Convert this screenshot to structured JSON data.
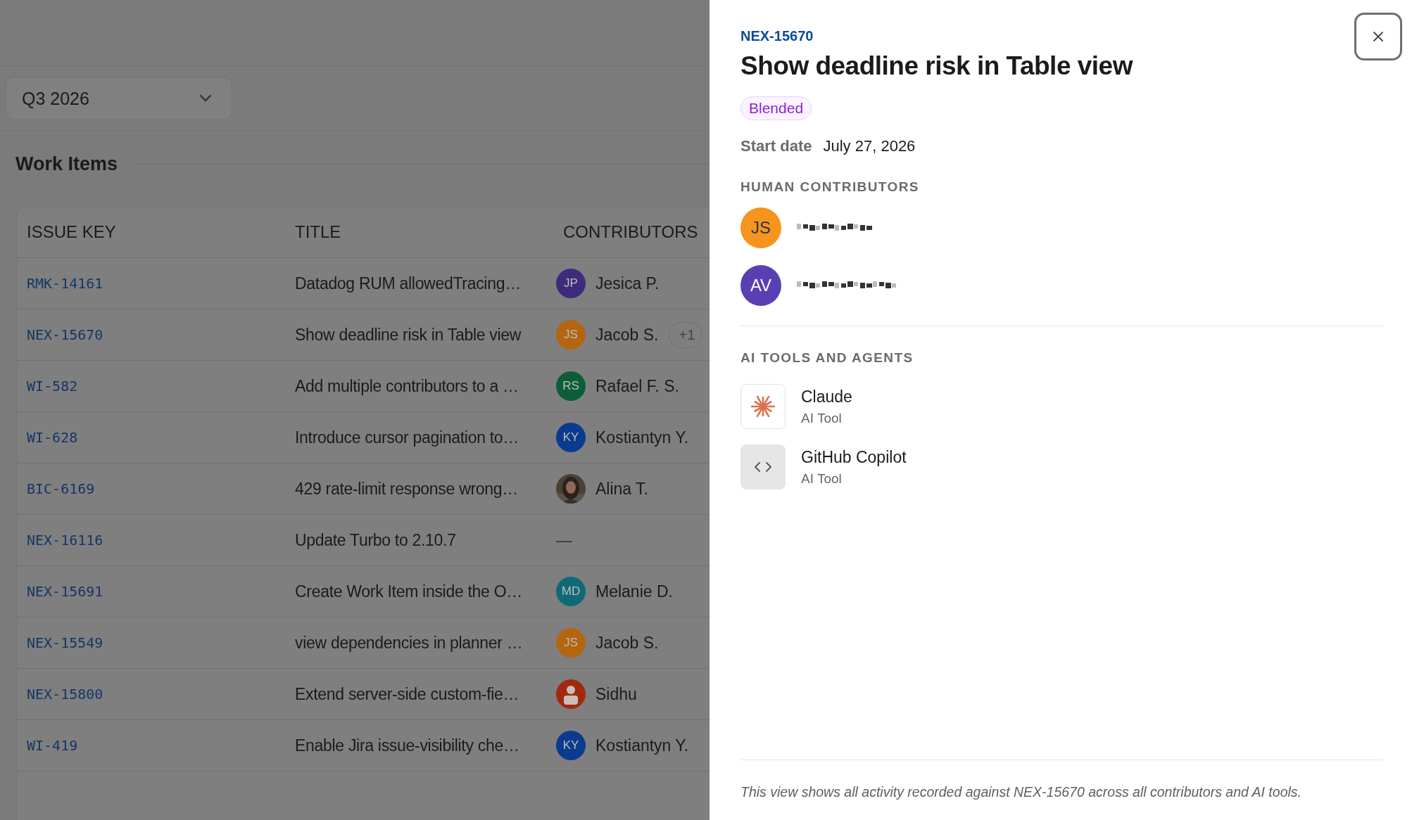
{
  "period_select": {
    "value": "Q3 2026"
  },
  "section_title": "Work Items",
  "table": {
    "columns": [
      "ISSUE KEY",
      "TITLE",
      "CONTRIBUTORS"
    ],
    "rows": [
      {
        "issue_key": "RMK-14161",
        "title": "Datadog RUM allowedTracing…",
        "contributor": {
          "kind": "initials",
          "initials": "JP",
          "name": "Jesica P.",
          "color": "#3f2b7c"
        }
      },
      {
        "issue_key": "NEX-15670",
        "title": "Show deadline risk in Table view",
        "contributor": {
          "kind": "initials",
          "initials": "JS",
          "name": "Jacob S.",
          "color": "#b3660f"
        },
        "extra": "+1"
      },
      {
        "issue_key": "WI-582",
        "title": "Add multiple contributors to a …",
        "contributor": {
          "kind": "initials",
          "initials": "RS",
          "name": "Rafael F. S.",
          "color": "#0d5e38"
        }
      },
      {
        "issue_key": "WI-628",
        "title": "Introduce cursor pagination to…",
        "contributor": {
          "kind": "initials",
          "initials": "KY",
          "name": "Kostiantyn Y.",
          "color": "#0b3b8e"
        }
      },
      {
        "issue_key": "BIC-6169",
        "title": "429 rate-limit response wrong…",
        "contributor": {
          "name": "Alina T."
        }
      },
      {
        "issue_key": "NEX-16116",
        "title": "Update Turbo to 2.10.7",
        "contributor": {
          "kind": "none",
          "name": "—"
        }
      },
      {
        "issue_key": "NEX-15691",
        "title": "Create Work Item inside the O…",
        "contributor": {
          "kind": "initials",
          "initials": "MD",
          "name": "Melanie D.",
          "color": "#0f6a78"
        }
      },
      {
        "issue_key": "NEX-15549",
        "title": "view dependencies in planner …",
        "contributor": {
          "kind": "initials",
          "initials": "JS",
          "name": "Jacob S.",
          "color": "#b3660f"
        }
      },
      {
        "issue_key": "NEX-15800",
        "title": "Extend server-side custom-fie…",
        "contributor": {
          "kind": "generic",
          "name": "Sidhu",
          "color": "#a12a0e"
        }
      },
      {
        "issue_key": "WI-419",
        "title": "Enable Jira issue-visibility che…",
        "contributor": {
          "kind": "initials",
          "initials": "KY",
          "name": "Kostiantyn Y.",
          "color": "#0b3b8e"
        }
      }
    ]
  },
  "drawer": {
    "issue_key": "NEX-15670",
    "title": "Show deadline risk in Table view",
    "badge": "Blended",
    "start_date": {
      "label": "Start date",
      "value": "July 27, 2026"
    },
    "human_contributors": {
      "heading": "HUMAN CONTRIBUTORS",
      "people": [
        {
          "initials": "JS",
          "color": "#f7941d"
        },
        {
          "initials": "AV",
          "color": "#5a3fb3"
        }
      ]
    },
    "ai_tools": {
      "heading": "AI TOOLS AND AGENTS",
      "tools": [
        {
          "kind": "claude",
          "name": "Claude",
          "subtitle": "AI Tool"
        },
        {
          "kind": "code",
          "name": "GitHub Copilot",
          "subtitle": "AI Tool"
        }
      ]
    },
    "footer": "This view shows all activity recorded against NEX-15670 across all contributors and AI tools."
  }
}
